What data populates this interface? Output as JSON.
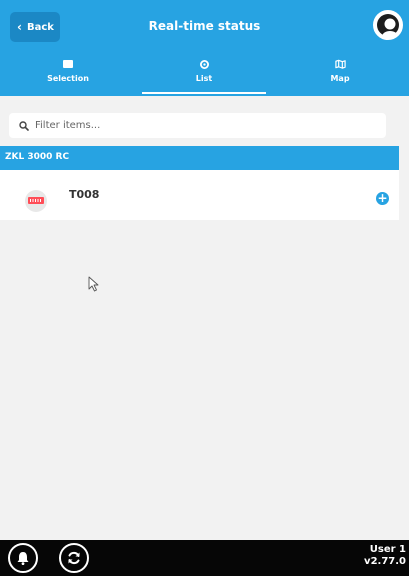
{
  "header": {
    "back_label": "Back",
    "title": "Real-time status",
    "avatar_icon": "user-icon"
  },
  "tabs": [
    {
      "label": "Selection",
      "icon": "list-rect-icon",
      "active": false
    },
    {
      "label": "List",
      "icon": "settings-dot-icon",
      "active": true
    },
    {
      "label": "Map",
      "icon": "map-icon",
      "active": false
    }
  ],
  "filter": {
    "placeholder": "Filter items...",
    "value": "",
    "icon": "search-icon"
  },
  "group": {
    "label": "ZKL 3000 RC"
  },
  "items": [
    {
      "name": "T008",
      "icon": "device-icon",
      "action_icon": "add-circle-icon"
    }
  ],
  "footer": {
    "user": "User 1",
    "version": "v2.77.0",
    "bell_icon": "bell-icon",
    "refresh_icon": "refresh-icon"
  },
  "colors": {
    "accent": "#27a3e2",
    "accent_dark": "#1b88c5",
    "background": "#f2f2f2",
    "footer": "#060606",
    "device_red": "#ff4d57"
  }
}
